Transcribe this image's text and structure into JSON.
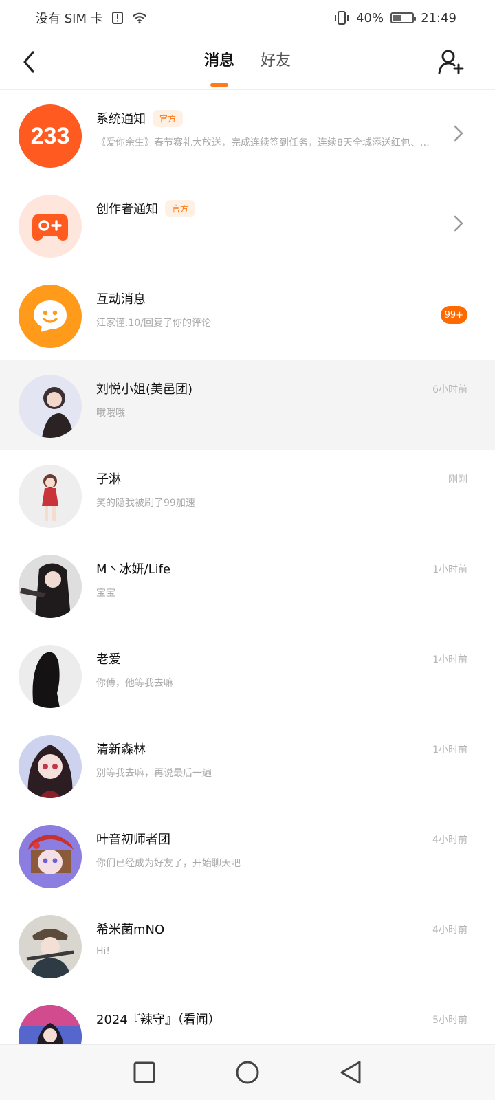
{
  "status_bar": {
    "carrier": "没有 SIM 卡",
    "battery": "40%",
    "time": "21:49",
    "battery_level": 0.4
  },
  "header": {
    "tabs": [
      {
        "label": "消息",
        "active": true
      },
      {
        "label": "好友",
        "active": false
      }
    ]
  },
  "system_items": [
    {
      "title": "系统通知",
      "tag": "官方",
      "preview": "《爱你余生》春节赛礼大放送，完成连续签到任务，连续8天全城添送红包、…",
      "avatar_label": "233",
      "avatar_color": "#ff5a1f"
    },
    {
      "title": "创作者通知",
      "tag": "官方",
      "preview": "",
      "avatar_color": "#ffe6dc",
      "icon": "gamepad-plus-icon"
    },
    {
      "title": "互动消息",
      "preview": "江家谨.10/回复了你的评论",
      "badge": "99+",
      "avatar_color": "#ff9a1a",
      "icon": "smile-bubble-icon"
    }
  ],
  "conversations": [
    {
      "name": "刘悦小姐(美邑团)",
      "preview": "哦哦哦",
      "time": "6小时前",
      "avatar_color": "#e3e5f2",
      "highlight": true
    },
    {
      "name": "子淋",
      "preview": "笑的隐我被刷了99加速",
      "time": "刚刚",
      "avatar_color": "#eeeeef"
    },
    {
      "name": "M丶冰妍/Life",
      "preview": "宝宝",
      "time": "1小时前",
      "avatar_color": "#dedede"
    },
    {
      "name": "老爱",
      "preview": "你傅，他等我去嘛",
      "time": "1小时前",
      "avatar_color": "#ececec"
    },
    {
      "name": "清新森林",
      "preview": "别等我去嘛，再说最后一遍",
      "time": "1小时前",
      "avatar_color": "#cdd3ef"
    },
    {
      "name": "叶音初师者团",
      "preview": "你们已经成为好友了，开始聊天吧",
      "time": "4小时前",
      "avatar_color": "#8b7ee0"
    },
    {
      "name": "希米菌mNO",
      "preview": "Hi!",
      "time": "4小时前",
      "avatar_color": "#d9d6d0"
    },
    {
      "name": "2024『辣守』（看闻）",
      "preview": "",
      "time": "5小时前",
      "avatar_color": "#6a78d8"
    }
  ]
}
